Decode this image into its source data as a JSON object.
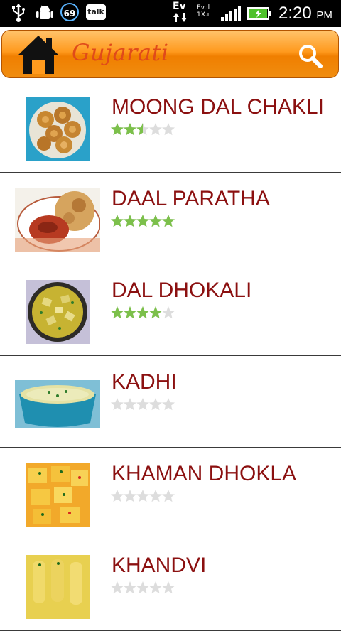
{
  "status_bar": {
    "notification_count": "69",
    "talk_label": "talk",
    "ev_label": "Ev",
    "ev_small": "Ev.ıl",
    "onex_small": "1X.ıl",
    "time": "2:20",
    "ampm": "PM"
  },
  "header": {
    "title": "Gujarati"
  },
  "recipes": [
    {
      "name": "MOONG DAL CHAKLI",
      "rating": 2.5
    },
    {
      "name": "DAAL PARATHA",
      "rating": 5
    },
    {
      "name": "DAL DHOKALI",
      "rating": 4
    },
    {
      "name": "KADHI",
      "rating": 0
    },
    {
      "name": "KHAMAN DHOKLA",
      "rating": 0
    },
    {
      "name": "KHANDVI",
      "rating": 0
    }
  ],
  "colors": {
    "title_text": "#8b1010",
    "star_filled": "#7cc04b",
    "star_empty": "#dddddd",
    "header_orange": "#f08d10"
  }
}
